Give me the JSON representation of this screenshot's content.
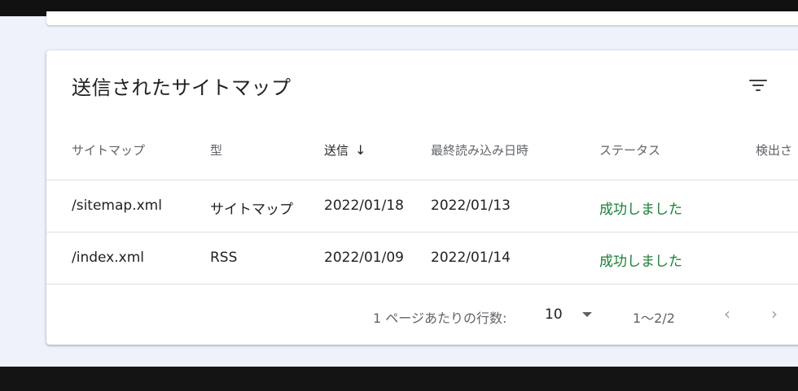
{
  "card": {
    "title": "送信されたサイトマップ"
  },
  "table": {
    "columns": [
      "サイトマップ",
      "型",
      "送信",
      "最終読み込み日時",
      "ステータス",
      "検出さ"
    ],
    "sort_arrow": "↓",
    "rows": [
      {
        "sitemap": "/sitemap.xml",
        "type": "サイトマップ",
        "submitted": "2022/01/18",
        "last_read": "2022/01/13",
        "status": "成功しました"
      },
      {
        "sitemap": "/index.xml",
        "type": "RSS",
        "submitted": "2022/01/09",
        "last_read": "2022/01/14",
        "status": "成功しました"
      }
    ]
  },
  "pagination": {
    "rows_per_page_label": "1 ページあたりの行数:",
    "rows_per_page_value": "10",
    "range": "1〜2/2",
    "prev_icon": "‹",
    "next_icon": "›"
  },
  "colors": {
    "status_success": "#188038",
    "page_background": "#eef2fa"
  },
  "icons": [
    "filter-icon",
    "arrow-down-icon",
    "caret-down-icon",
    "chevron-left-icon",
    "chevron-right-icon"
  ]
}
